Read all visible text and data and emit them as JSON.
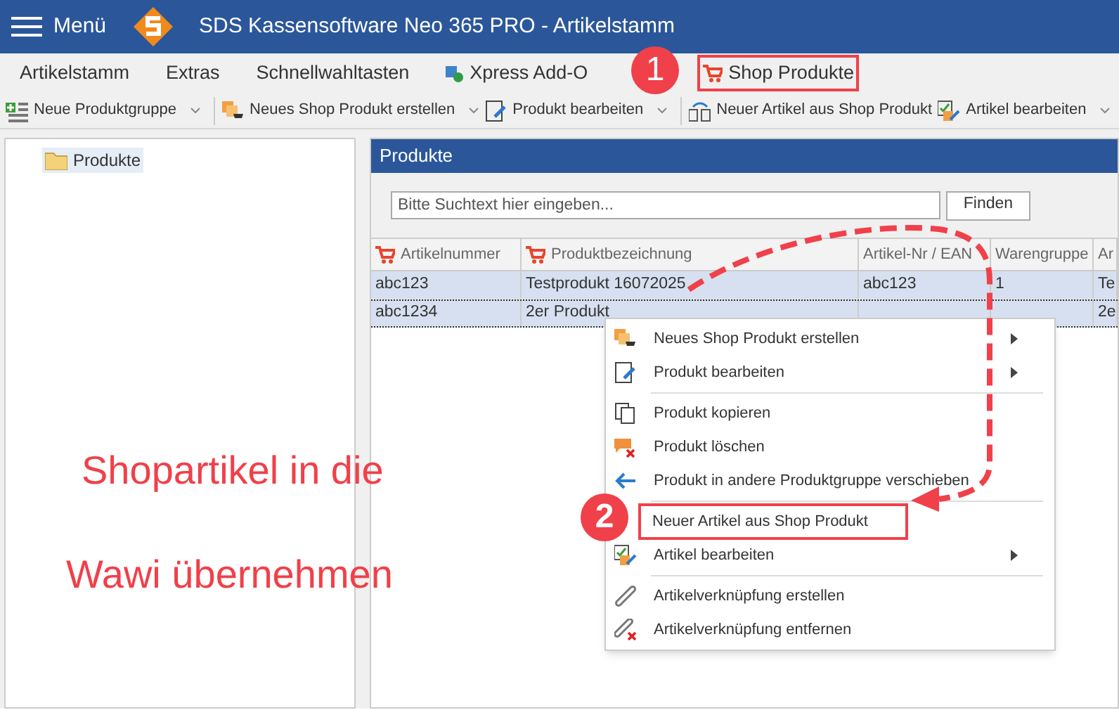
{
  "window": {
    "menu_label": "Menü",
    "title": "SDS Kassensoftware Neo 365 PRO - Artikelstamm"
  },
  "tabs": [
    {
      "label": "Artikelstamm",
      "highlighted": false
    },
    {
      "label": "Extras",
      "highlighted": false
    },
    {
      "label": "Schnellwahltasten",
      "highlighted": false
    },
    {
      "label": "Xpress Add-O",
      "highlighted": false
    },
    {
      "label": "Shop Produkte",
      "highlighted": true
    }
  ],
  "toolbar": {
    "groups": [
      [
        {
          "label": "Neue Produktgruppe",
          "dropdown": true
        }
      ],
      [
        {
          "label": "Neues Shop Produkt erstellen",
          "dropdown": true
        },
        {
          "label": "Produkt bearbeiten",
          "dropdown": true
        }
      ],
      [
        {
          "label": "Neuer Artikel aus Shop Produkt",
          "dropdown": false
        },
        {
          "label": "Artikel bearbeiten",
          "dropdown": true
        }
      ]
    ]
  },
  "tree": {
    "items": [
      {
        "label": "Produkte",
        "selected": true
      }
    ]
  },
  "panel": {
    "title": "Produkte",
    "search": {
      "placeholder": "Bitte Suchtext hier eingeben..."
    },
    "find_button": "Finden"
  },
  "table": {
    "columns": [
      "Artikelnummer",
      "Produktbezeichnung",
      "Artikel-Nr / EAN",
      "Warengruppe",
      "Ar"
    ],
    "rows": [
      {
        "cells": [
          "abc123",
          "Testprodukt 16072025",
          "abc123",
          "1",
          "Te"
        ],
        "selected": true,
        "focused": false
      },
      {
        "cells": [
          "abc1234",
          "2er Produkt",
          "",
          "",
          "2e"
        ],
        "selected": true,
        "focused": true
      }
    ]
  },
  "context_menu": {
    "groups": [
      [
        {
          "label": "Neues Shop Produkt erstellen",
          "submenu": true,
          "highlighted": false
        },
        {
          "label": "Produkt bearbeiten",
          "submenu": true,
          "highlighted": false
        }
      ],
      [
        {
          "label": "Produkt kopieren",
          "submenu": false,
          "highlighted": false
        },
        {
          "label": "Produkt löschen",
          "submenu": false,
          "highlighted": false
        },
        {
          "label": "Produkt in andere Produktgruppe verschieben",
          "submenu": false,
          "highlighted": false
        }
      ],
      [
        {
          "label": "Neuer Artikel aus Shop Produkt",
          "submenu": false,
          "highlighted": true
        },
        {
          "label": "Artikel bearbeiten",
          "submenu": true,
          "highlighted": false
        }
      ],
      [
        {
          "label": "Artikelverknüpfung erstellen",
          "submenu": false,
          "highlighted": false
        },
        {
          "label": "Artikelverknüpfung entfernen",
          "submenu": false,
          "highlighted": false
        }
      ]
    ]
  },
  "annotations": {
    "badges": [
      "1",
      "2"
    ],
    "caption": [
      "Shopartikel in die",
      "Wawi übernehmen"
    ]
  }
}
